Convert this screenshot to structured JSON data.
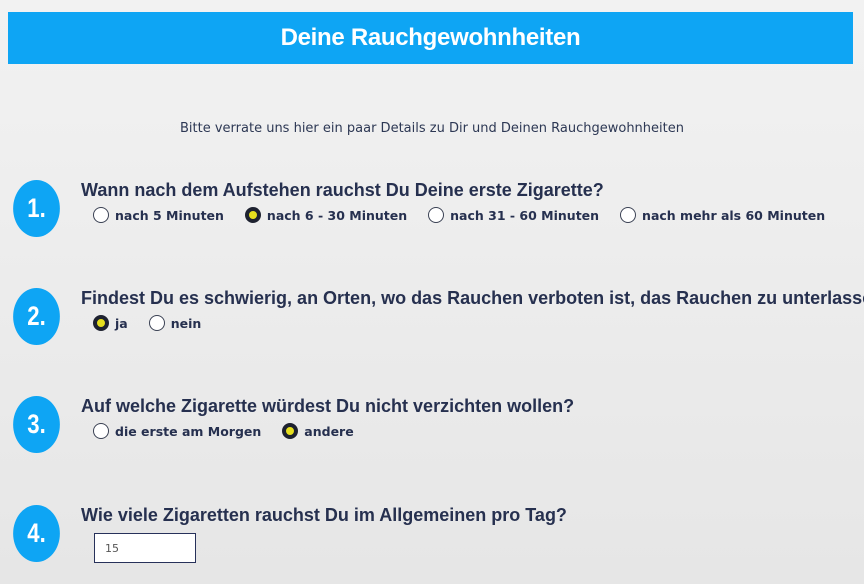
{
  "header": {
    "title": "Deine Rauchgewohnheiten"
  },
  "intro": "Bitte verrate uns hier ein paar Details zu Dir und Deinen Rauchgewohnheiten",
  "colors": {
    "accent": "#0ea5f4",
    "text": "#26304f",
    "radio_selected": "#e6df1e"
  },
  "questions": [
    {
      "number": "1.",
      "text": "Wann nach dem Aufstehen rauchst Du Deine erste Zigarette?",
      "options": [
        {
          "label": "nach 5 Minuten",
          "selected": false
        },
        {
          "label": "nach 6 - 30 Minuten",
          "selected": true
        },
        {
          "label": "nach 31 - 60 Minuten",
          "selected": false
        },
        {
          "label": "nach mehr als 60 Minuten",
          "selected": false
        }
      ]
    },
    {
      "number": "2.",
      "text": "Findest Du es schwierig, an Orten, wo das Rauchen verboten ist, das Rauchen zu unterlassen?",
      "options": [
        {
          "label": "ja",
          "selected": true
        },
        {
          "label": "nein",
          "selected": false
        }
      ]
    },
    {
      "number": "3.",
      "text": "Auf welche Zigarette würdest Du nicht verzichten wollen?",
      "options": [
        {
          "label": "die erste am Morgen",
          "selected": false
        },
        {
          "label": "andere",
          "selected": true
        }
      ]
    },
    {
      "number": "4.",
      "text": "Wie viele Zigaretten rauchst Du im Allgemeinen pro Tag?",
      "input_value": "15"
    }
  ]
}
